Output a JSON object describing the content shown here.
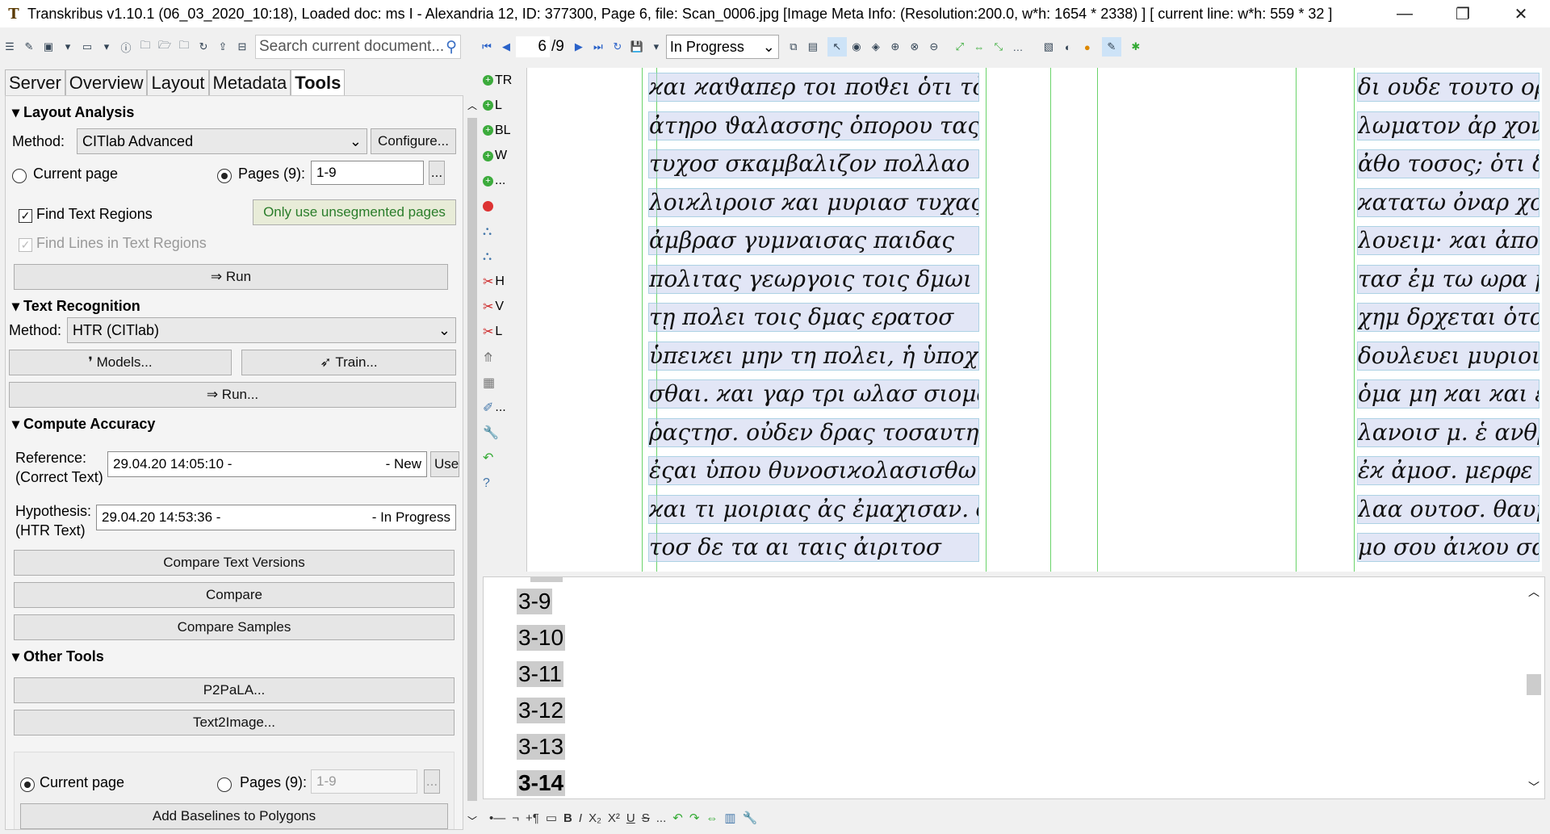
{
  "window": {
    "title": "Transkribus v1.10.1 (06_03_2020_10:18), Loaded doc: ms I - Alexandria 12, ID: 377300, Page 6, file: Scan_0006.jpg [Image Meta Info: (Resolution:200.0, w*h: 1654 * 2338) ] [ current line: w*h: 559 * 32 ]",
    "minimize": "—",
    "maximize": "❐",
    "close": "✕"
  },
  "toolbar": {
    "search_placeholder": "Search current document...",
    "page_current": "6",
    "page_total": "/9",
    "status": "In Progress"
  },
  "tabs": [
    "Server",
    "Overview",
    "Layout",
    "Metadata",
    "Tools"
  ],
  "layout_analysis": {
    "header": "Layout Analysis",
    "method_label": "Method:",
    "method_value": "CITlab Advanced",
    "configure": "Configure...",
    "current_page": "Current page",
    "pages_label": "Pages (9):",
    "pages_value": "1-9",
    "dots": "...",
    "find_text_regions": "Find Text Regions",
    "only_unsegmented": "Only use unsegmented pages",
    "find_lines": "Find Lines in Text Regions",
    "run": "⇒ Run"
  },
  "text_recognition": {
    "header": "Text Recognition",
    "method_label": "Method:",
    "method_value": "HTR (CITlab)",
    "models": "Models...",
    "train": "Train...",
    "run": "⇒ Run..."
  },
  "compute_accuracy": {
    "header": "Compute Accuracy",
    "reference_label_1": "Reference:",
    "reference_label_2": "(Correct Text)",
    "reference_value": "29.04.20 14:05:10 -",
    "reference_status": "- New",
    "use_btn": "Use",
    "hypothesis_label_1": "Hypothesis:",
    "hypothesis_label_2": "(HTR Text)",
    "hypothesis_value": "29.04.20 14:53:36 -",
    "hypothesis_status": "- In Progress",
    "compare_versions": "Compare Text Versions",
    "compare": "Compare",
    "compare_samples": "Compare Samples"
  },
  "other_tools": {
    "header": "Other Tools",
    "p2pala": "P2PaLA...",
    "text2image": "Text2Image...",
    "current_page": "Current page",
    "pages_label": "Pages (9):",
    "pages_value": "1-9",
    "dots": "...",
    "add_baselines": "Add Baselines to Polygons"
  },
  "icon_column": [
    "TR",
    "L",
    "BL",
    "W",
    "...",
    "",
    "",
    "",
    "H",
    "V",
    "L",
    "",
    "",
    "...",
    "",
    "",
    ""
  ],
  "manuscript_left": [
    "ϰαι ϰαϑαπερ τοι ποϑει ὁτι τὸ πολυ",
    "ἀτηρο ϑαλασσης ὁπορου τας",
    "τυχοσ σκαμβαλιζον πολλαο",
    "λοιϰλιροισ ϰαι μυριασ τυχας",
    "ἀμβρασ γυμναισας παιδας",
    "πολιτας γεωργοις τοις δμωι",
    "τῃ πολει τοις δμας ερατοσ",
    "ὑπειϰει μην τη πολει, ἡ ὑποχη",
    "σθαι. ϰαι γαρ τρι ωλασ σιομαι ἐς",
    "ῥαςτησ. οὐδεν δρας τοσαυτησ",
    "ἐςαι ὑπου θυνοσιϰολασισθω",
    "ϰαι τι μοιριας ἀς ἐμαχισαν. δυ",
    "τοσ δε τα αι ταις ἀιριτοσ"
  ],
  "manuscript_right": [
    "δι ουδε τουτο ορα",
    "λωματον ἀρ χοντ",
    "ἀθο τοσος; ὁτι δι",
    "ϰατατω ὀναρ χομ",
    "λουειμ· ϰαι ἀπο α",
    "τασ ἐμ τω ωρα μ",
    "χημ δρχεται ὁτοιο",
    "δουλευει μυριοισ",
    "ὁμα μη ϰαι ϰαι ἐπι",
    "λανοισ μ. ἑ ανθρω",
    "ἐϰ ἀμοσ. μερφε τα",
    "λαα ουτοσ. θαυμα",
    "μο σου ἀιϰου σας"
  ],
  "line_numbers": [
    "3-9",
    "3-10",
    "3-11",
    "3-12",
    "3-13",
    "3-14"
  ],
  "bottom_bar": [
    "•—",
    "¬",
    "+¶",
    "▭",
    "B",
    "I",
    "X₂",
    "X²",
    "U",
    "S",
    "...",
    "↶",
    "↷",
    "⇔",
    "▥",
    "🔧"
  ]
}
